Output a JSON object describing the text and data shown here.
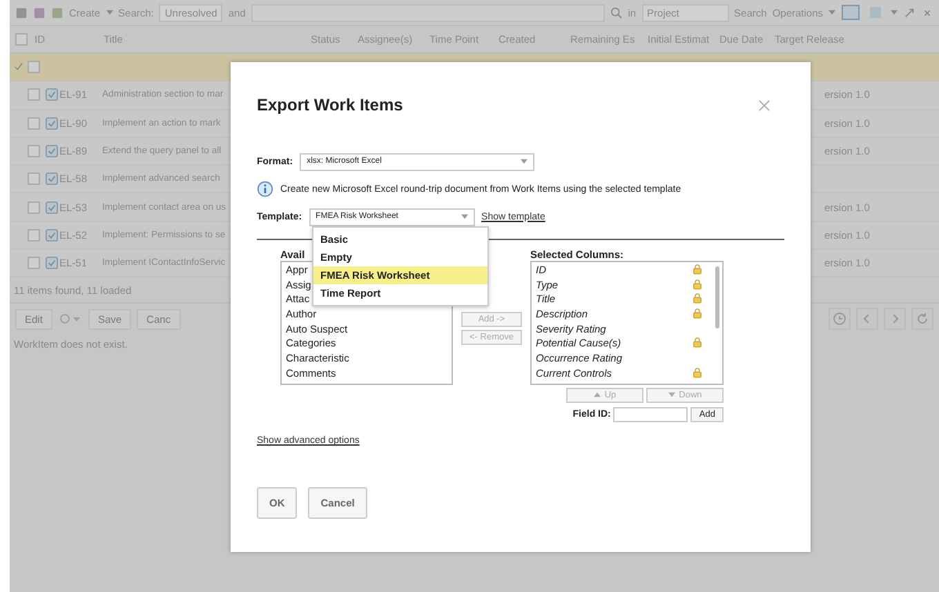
{
  "toolbar": {
    "create_menu": "Create",
    "search_label": "Search:",
    "query_filter": "Unresolved",
    "and_label": "and",
    "in_label": "in",
    "scope": "Project",
    "search_button": "Search",
    "operations_menu": "Operations"
  },
  "table": {
    "all_checked": false,
    "columns": [
      "ID",
      "Title",
      "Status",
      "Assignee(s)",
      "Time Point",
      "Created",
      "Remaining Es",
      "Initial Estimat",
      "Due Date",
      "Target Release"
    ],
    "rows": [
      {
        "selected": true
      },
      {
        "selected": false,
        "id": "EL-91",
        "title": "Administration section to mar",
        "target_release": "ersion 1.0"
      },
      {
        "selected": false,
        "id": "EL-90",
        "title": "Implement an action to mark",
        "target_release": "ersion 1.0"
      },
      {
        "selected": false,
        "id": "EL-89",
        "title": "Extend the query panel to all",
        "target_release": "ersion 1.0"
      },
      {
        "selected": false,
        "id": "EL-58",
        "title": "Implement advanced search"
      },
      {
        "selected": false,
        "id": "EL-53",
        "title": "Implement contact area on us",
        "target_release": "ersion 1.0"
      },
      {
        "selected": false,
        "id": "EL-52",
        "title": "Implement: Permissions to se",
        "target_release": "ersion 1.0"
      },
      {
        "selected": false,
        "id": "EL-51",
        "title": "Implement IContactInfoServic",
        "target_release": "ersion 1.0"
      }
    ]
  },
  "status": "11 items found, 11 loaded",
  "bottom_toolbar": {
    "edit": "Edit",
    "save": "Save",
    "cancel": "Canc"
  },
  "message": "WorkItem does not exist.",
  "dialog": {
    "title": "Export Work Items",
    "format_label": "Format:",
    "format_value": "xlsx: Microsoft Excel",
    "info": "Create new Microsoft Excel round-trip document from Work Items using the selected template",
    "template_label": "Template:",
    "template_value": "FMEA Risk Worksheet",
    "show_template": "Show template",
    "template_menu": [
      {
        "label": "Basic",
        "selected": false
      },
      {
        "label": "Empty",
        "selected": false
      },
      {
        "label": "FMEA Risk Worksheet",
        "selected": true
      },
      {
        "label": "Time Report",
        "selected": false
      }
    ],
    "available_label": "Avail",
    "available_columns": [
      "Appr",
      "Assig",
      "Attac",
      "Author",
      "Auto Suspect",
      "Categories",
      "Characteristic",
      "Comments"
    ],
    "add_button": {
      "label": "Add ->",
      "disabled": true
    },
    "remove_button": {
      "label": "<- Remove",
      "disabled": true
    },
    "selected_label": "Selected Columns:",
    "selected_columns": [
      {
        "name": "ID",
        "locked": true
      },
      {
        "name": "Type",
        "locked": true
      },
      {
        "name": "Title",
        "locked": true
      },
      {
        "name": "Description",
        "locked": true
      },
      {
        "name": "Severity Rating",
        "locked": false
      },
      {
        "name": "Potential Cause(s)",
        "locked": true
      },
      {
        "name": "Occurrence Rating",
        "locked": false
      },
      {
        "name": "Current Controls",
        "locked": true
      }
    ],
    "up_button": {
      "label": "Up",
      "disabled": true
    },
    "down_button": {
      "label": "Down",
      "disabled": true
    },
    "field_id_label": "Field ID:",
    "add_field_button": "Add",
    "advanced_link": "Show advanced options",
    "ok": "OK",
    "cancel": "Cancel"
  }
}
